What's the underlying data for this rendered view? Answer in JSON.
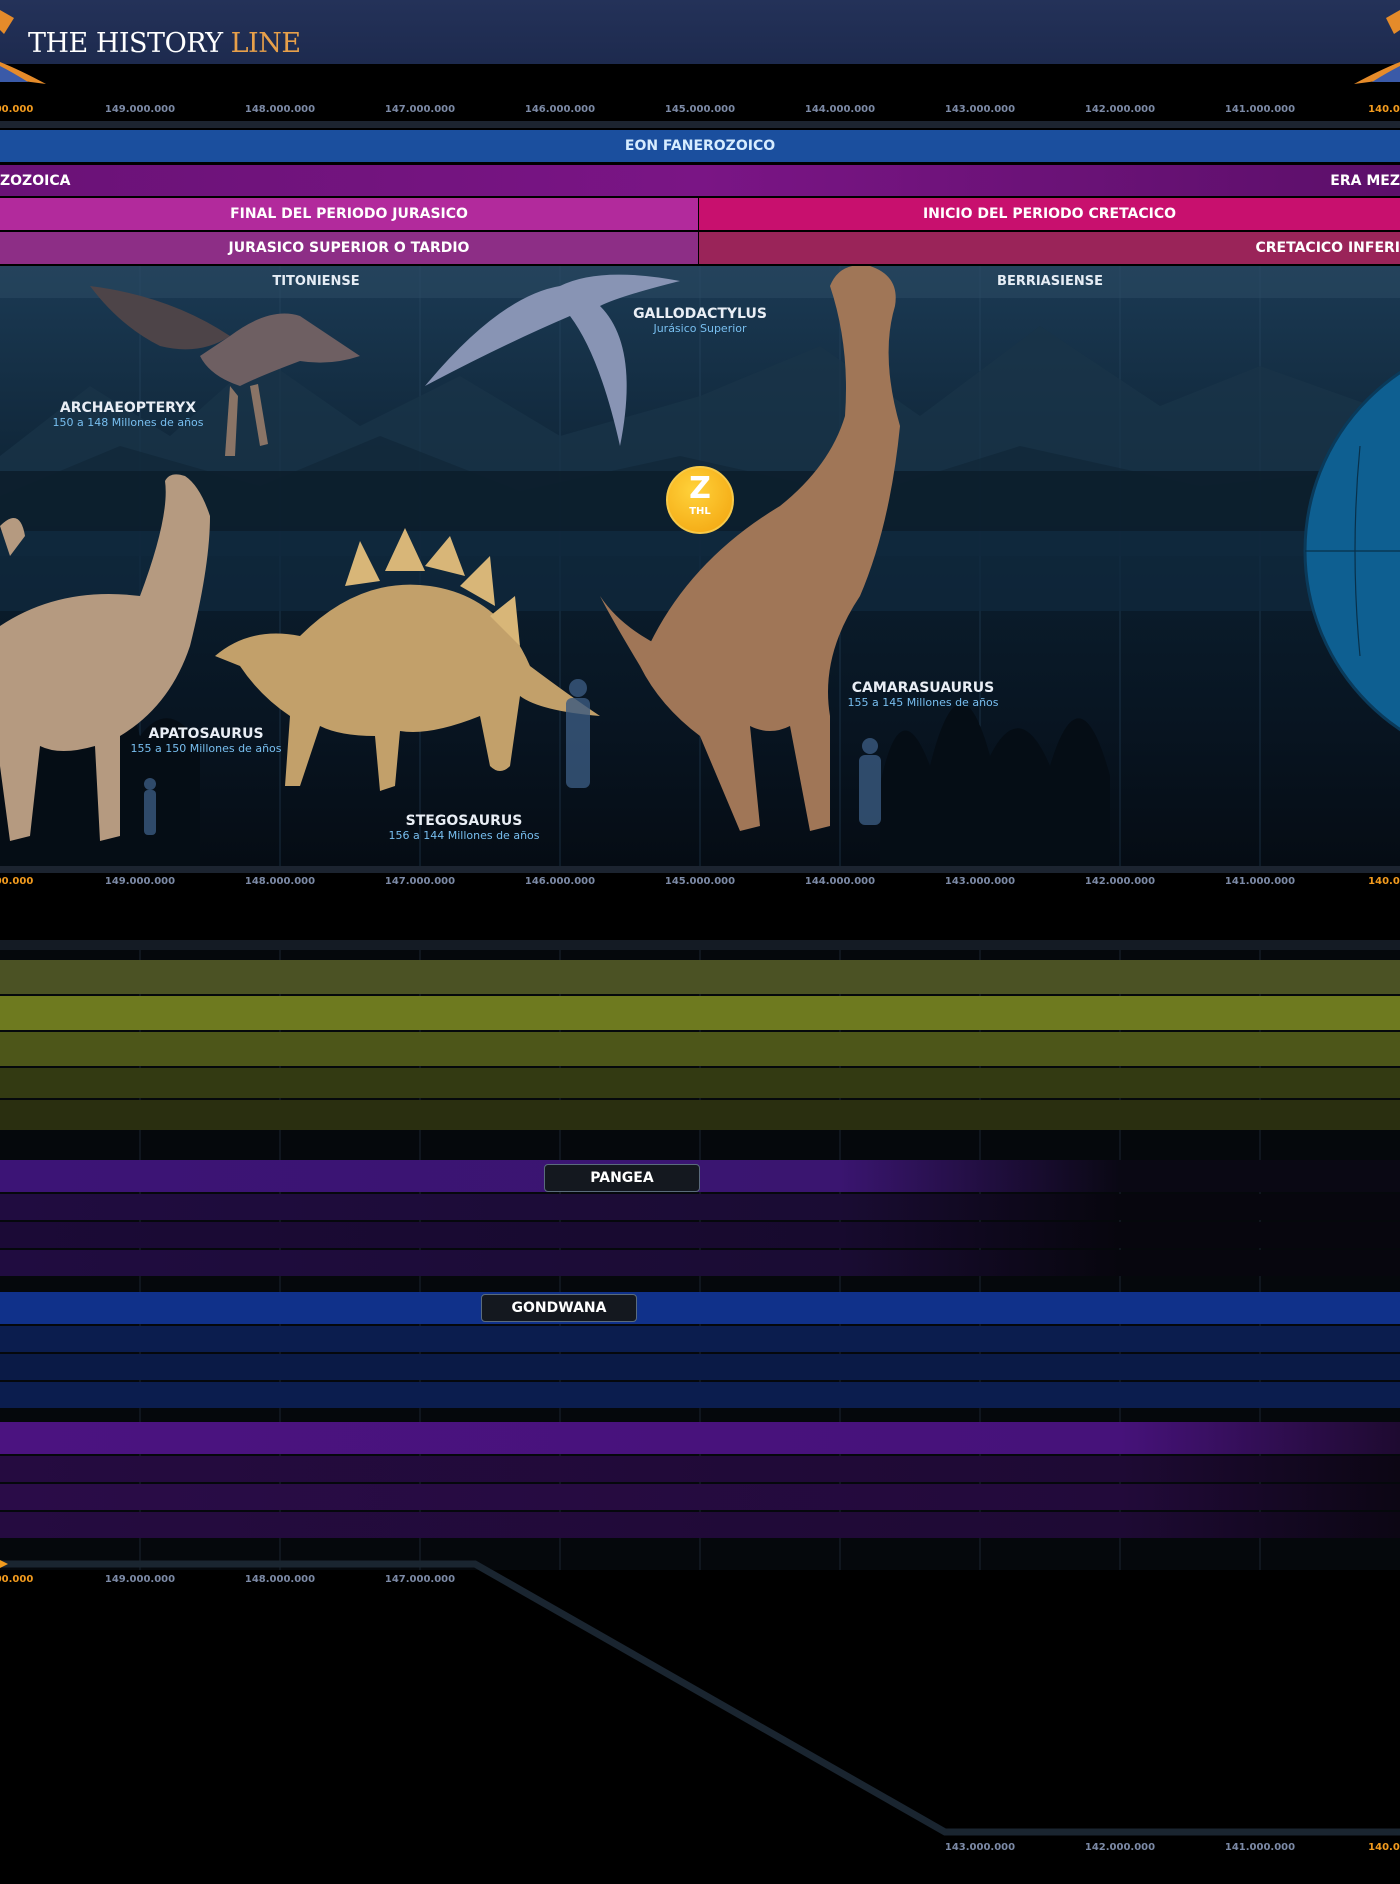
{
  "header": {
    "logo_main": "THE HISTORY ",
    "logo_accent": "LINE"
  },
  "ruler": {
    "labels": [
      "149.000.000",
      "148.000.000",
      "147.000.000",
      "146.000.000",
      "145.000.000",
      "144.000.000",
      "143.000.000",
      "142.000.000",
      "141.000.000"
    ],
    "left_edge": "00.000",
    "right_edge": "140.0"
  },
  "bands": {
    "eon": "EON FANEROZOICO",
    "era_left": "ZOZOICA",
    "era_right": "ERA MEZ",
    "period_left": "FINAL DEL PERIODO JURASICO",
    "period_right": "INICIO DEL PERIODO CRETACICO",
    "epoch_left": "JURASICO SUPERIOR O TARDIO",
    "epoch_right": "CRETACICO INFERI",
    "stage_left": "TITONIENSE",
    "stage_right": "BERRIASIENSE"
  },
  "creatures": [
    {
      "name": "ARCHAEOPTERYX",
      "range": "150 a 148 Millones de años"
    },
    {
      "name": "GALLODACTYLUS",
      "range": "Jurásico Superior"
    },
    {
      "name": "APATOSAURUS",
      "range": "155 a 150 Millones de años"
    },
    {
      "name": "STEGOSAURUS",
      "range": "156 a 144 Millones de años"
    },
    {
      "name": "CAMARASUAURUS",
      "range": "155 a 145 Millones de años"
    }
  ],
  "marker": {
    "letter": "Z",
    "sub": "THL"
  },
  "continents": {
    "pangea": "PANGEA",
    "gondwana": "GONDWANA"
  },
  "bottom_ruler": {
    "left_labels": [
      "149.000.000",
      "148.000.000",
      "147.000.000"
    ],
    "right_labels": [
      "143.000.000",
      "142.000.000",
      "141.000.000"
    ],
    "left_edge": "00.000",
    "right_edge": "140.0"
  },
  "colors": {
    "eon": "#1b4f9e",
    "era": "#6f1378",
    "period_left": "#b22a9c",
    "period_right": "#c8106e",
    "epoch_left": "#8d2e86",
    "epoch_right": "#9a2459",
    "accent_orange": "#f29b1e",
    "pangea": "#3c1476",
    "gondwana": "#10318a"
  }
}
